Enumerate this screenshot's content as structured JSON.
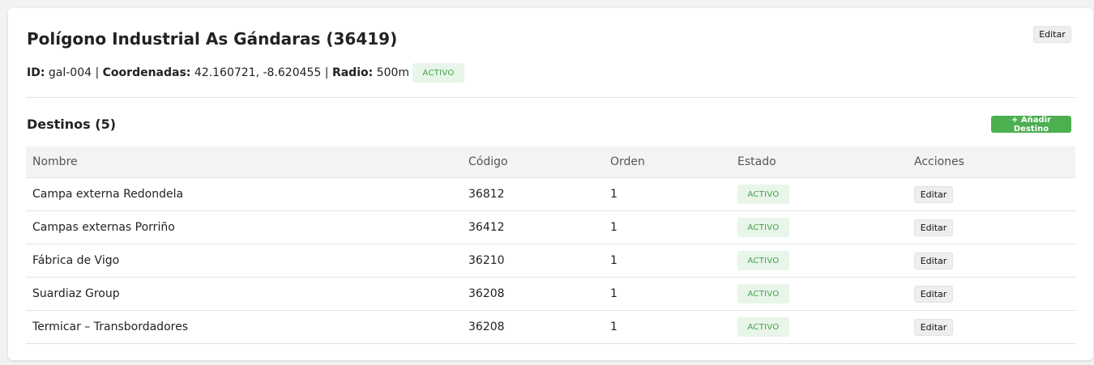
{
  "header": {
    "title": "Polígono Industrial As Gándaras (36419)",
    "edit_label": "Editar"
  },
  "meta": {
    "id_label": "ID:",
    "id_value": "gal-004",
    "sep": "|",
    "coords_label": "Coordenadas:",
    "coords_value": "42.160721, -8.620455",
    "radius_label": "Radio:",
    "radius_value": "500m",
    "status": "ACTIVO"
  },
  "destinations": {
    "title": "Destinos (5)",
    "add_label": "+ Añadir Destino",
    "columns": [
      "Nombre",
      "Código",
      "Orden",
      "Estado",
      "Acciones"
    ],
    "rows": [
      {
        "name": "Campa externa Redondela",
        "code": "36812",
        "order": "1",
        "status": "ACTIVO",
        "action": "Editar"
      },
      {
        "name": "Campas externas Porriño",
        "code": "36412",
        "order": "1",
        "status": "ACTIVO",
        "action": "Editar"
      },
      {
        "name": "Fábrica de Vigo",
        "code": "36210",
        "order": "1",
        "status": "ACTIVO",
        "action": "Editar"
      },
      {
        "name": "Suardiaz Group",
        "code": "36208",
        "order": "1",
        "status": "ACTIVO",
        "action": "Editar"
      },
      {
        "name": "Termicar – Transbordadores",
        "code": "36208",
        "order": "1",
        "status": "ACTIVO",
        "action": "Editar"
      }
    ]
  },
  "colors": {
    "accent": "#4caf50",
    "badge_bg": "#e8f5e9",
    "badge_text": "#43a047"
  }
}
